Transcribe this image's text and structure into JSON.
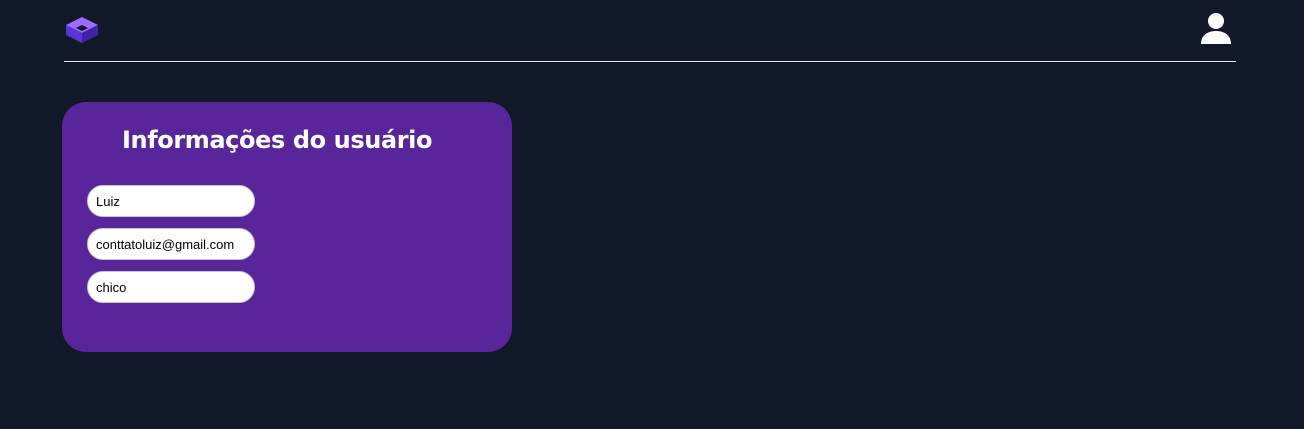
{
  "header": {
    "logo_icon": "logo-cube-icon",
    "user_icon": "user-account-icon",
    "accent_color": "#6d4aff"
  },
  "user_info": {
    "title": "Informações do usuário",
    "fields": [
      {
        "value": "Luiz"
      },
      {
        "value": "conttatoluiz@gmail.com"
      },
      {
        "value": "chico"
      }
    ]
  },
  "colors": {
    "background": "#111827",
    "card": "#58259b",
    "text": "#ffffff"
  }
}
